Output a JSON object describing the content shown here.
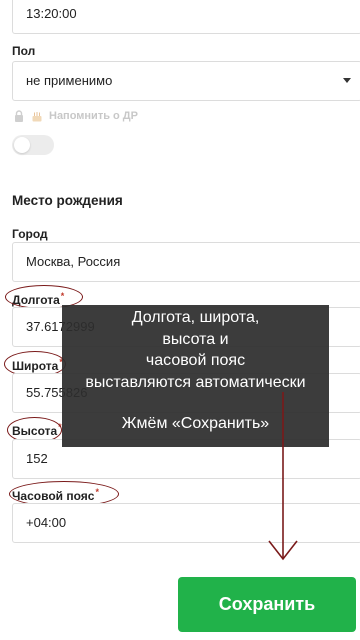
{
  "time_field": {
    "value": "13:20:00"
  },
  "gender": {
    "label": "Пол",
    "value": "не применимо"
  },
  "remind_birthday": {
    "label": "Напомнить о ДР",
    "enabled": false
  },
  "birthplace": {
    "title": "Место рождения",
    "city": {
      "label": "Город",
      "value": "Москва, Россия"
    },
    "longitude": {
      "label": "Долгота",
      "value": "37.6172999"
    },
    "latitude": {
      "label": "Широта",
      "value": "55.755826"
    },
    "altitude": {
      "label": "Высота",
      "value": "152"
    },
    "timezone": {
      "label": "Часовой пояс",
      "value": "+04:00"
    }
  },
  "required_mark": "*",
  "annotation": {
    "line1": "Долгота, широта,",
    "line2": "высота и",
    "line3": "часовой пояс",
    "line4": "выставляются автоматически",
    "line5": "Жмём «Сохранить»"
  },
  "save_button": {
    "label": "Сохранить"
  },
  "colors": {
    "save_button": "#21b24a",
    "annotation_marks": "#7a1a1a",
    "overlay": "#2d2d2d"
  }
}
